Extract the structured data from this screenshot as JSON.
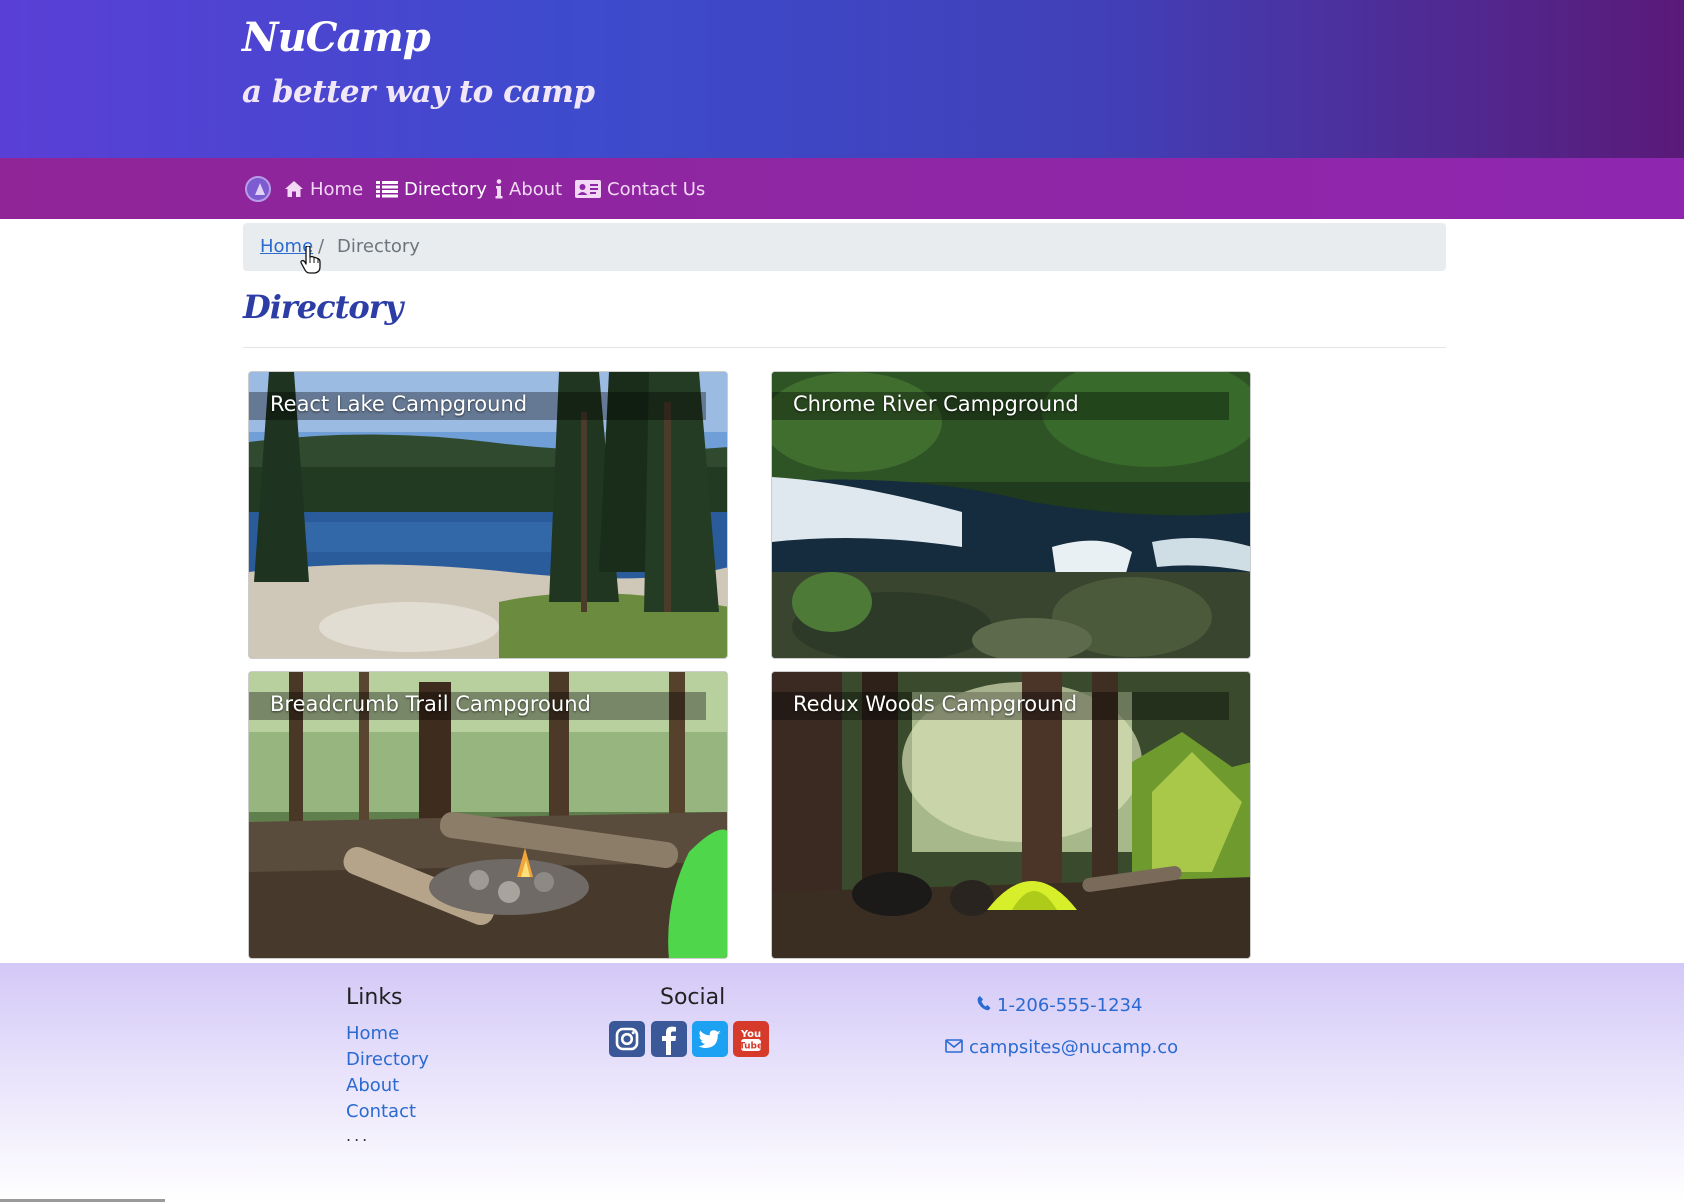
{
  "header": {
    "brand": "NuCamp",
    "tagline": "a better way to camp"
  },
  "nav": {
    "items": [
      {
        "label": "Home",
        "icon": "home-icon",
        "active": false
      },
      {
        "label": "Directory",
        "icon": "list-icon",
        "active": true
      },
      {
        "label": "About",
        "icon": "info-icon",
        "active": false
      },
      {
        "label": "Contact Us",
        "icon": "address-card-icon",
        "active": false
      }
    ]
  },
  "breadcrumb": {
    "home": "Home",
    "separator": "/",
    "current": "Directory"
  },
  "page": {
    "heading": "Directory"
  },
  "campsites": [
    {
      "name": "React Lake Campground"
    },
    {
      "name": "Chrome River Campground"
    },
    {
      "name": "Breadcrumb Trail Campground"
    },
    {
      "name": "Redux Woods Campground"
    }
  ],
  "footer": {
    "links_heading": "Links",
    "links": [
      "Home",
      "Directory",
      "About",
      "Contact"
    ],
    "ellipsis": "...",
    "social_heading": "Social",
    "social": [
      {
        "icon": "instagram-icon",
        "color": "#3a5897"
      },
      {
        "icon": "facebook-icon",
        "color": "#3b5998"
      },
      {
        "icon": "twitter-icon",
        "color": "#1da1f2"
      },
      {
        "icon": "youtube-icon",
        "color": "#d63a2b"
      }
    ],
    "phone": "1-206-555-1234",
    "email": "campsites@nucamp.co"
  },
  "colors": {
    "header_gradient": [
      "#5a3fd6",
      "#3d4bcc",
      "#5a1a78"
    ],
    "navbar": "#8f26a8",
    "heading": "#2d3da6",
    "link": "#2a6ad1"
  }
}
